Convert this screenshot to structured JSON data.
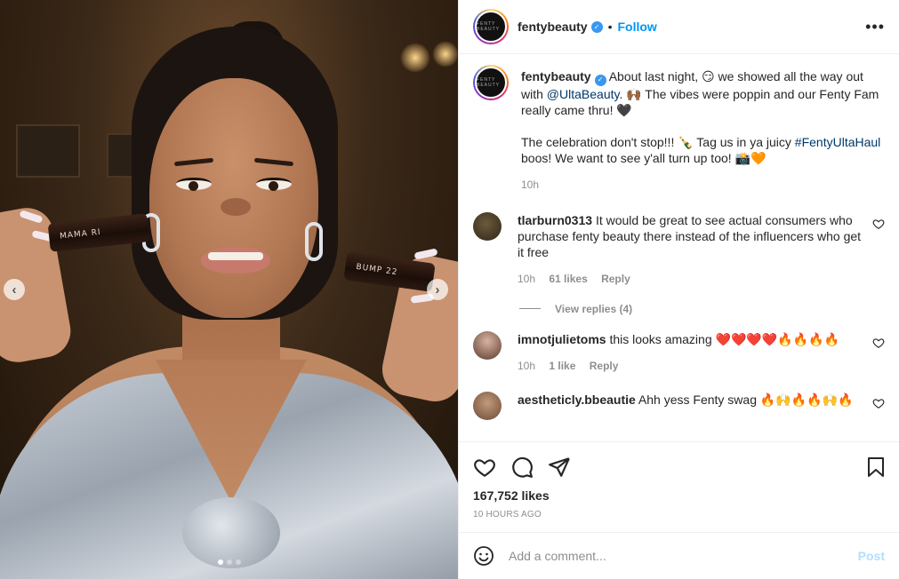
{
  "post": {
    "username": "fentybeauty",
    "follow_label": "Follow",
    "more_label": "•••",
    "avatar_text": "FENTY BEAUTY",
    "media": {
      "tube_left_label": "MAMA RI",
      "tube_right_label": "BUMP 22",
      "prev_arrow": "‹",
      "next_arrow": "›"
    }
  },
  "caption": {
    "username": "fentybeauty",
    "text_1": "About last night, 😏 we showed all the way out with ",
    "mention": "@UltaBeauty",
    "text_2": ". 🙌🏾 The vibes were poppin and our Fenty Fam really came thru! 🖤",
    "text_3": "The celebration don't stop!!! 🍾 Tag us in ya juicy ",
    "hashtag": "#FentyUltaHaul",
    "text_4": " boos! We want to see y'all turn up too! 📸🧡",
    "time": "10h"
  },
  "comments": [
    {
      "username": "tlarburn0313",
      "text": "It would be great to see actual consumers who purchase fenty beauty there instead of the influencers who get it free",
      "time": "10h",
      "likes": "61 likes",
      "reply": "Reply",
      "view_replies": "View replies (4)"
    },
    {
      "username": "imnotjulietoms",
      "text": "this looks amazing ❤️❤️❤️❤️🔥🔥🔥🔥",
      "time": "10h",
      "likes": "1 like",
      "reply": "Reply"
    },
    {
      "username": "aestheticly.bbeautie",
      "text": "Ahh yess Fenty swag 🔥🙌🔥🔥🙌🔥"
    }
  ],
  "stats": {
    "likes": "167,752 likes",
    "posted": "10 HOURS AGO"
  },
  "composer": {
    "placeholder": "Add a comment...",
    "post_label": "Post"
  },
  "icons": {
    "like": "heart-icon",
    "comment": "comment-icon",
    "share": "paper-plane-icon",
    "save": "bookmark-icon",
    "emoji": "smiley-icon",
    "verified": "verified-badge-icon"
  },
  "colors": {
    "link": "#0095f6",
    "mention": "#00376b",
    "muted": "#8e8e8e",
    "post_disabled": "#b2dffc"
  }
}
